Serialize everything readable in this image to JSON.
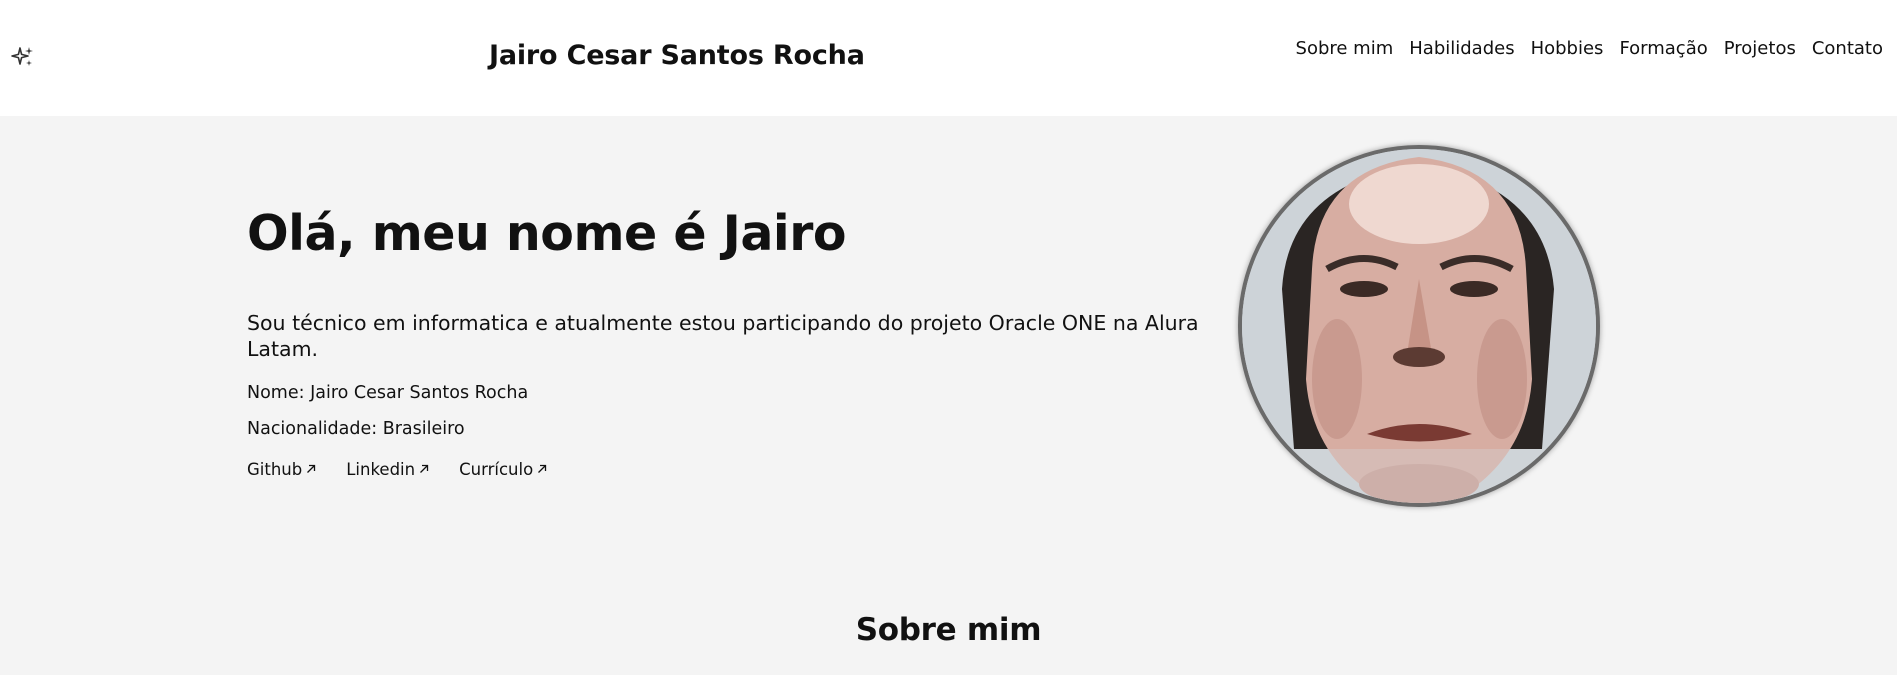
{
  "header": {
    "icon": "sparkle-icon",
    "site_title": "Jairo Cesar Santos Rocha",
    "nav": [
      "Sobre mim",
      "Habilidades",
      "Hobbies",
      "Formação",
      "Projetos",
      "Contato"
    ]
  },
  "hero": {
    "heading": "Olá, meu nome é Jairo",
    "description": "Sou técnico em informatica e atualmente estou participando do projeto Oracle ONE na Alura Latam.",
    "name_line": "Nome: Jairo Cesar Santos Rocha",
    "nationality_line": "Nacionalidade: Brasileiro",
    "links": [
      "Github",
      "Linkedin",
      "Currículo"
    ],
    "link_icon": "arrow-up-right-icon"
  },
  "sections": {
    "about_title": "Sobre mim"
  },
  "colors": {
    "header_bg": "#ffffff",
    "page_bg": "#f4f4f4",
    "text": "#111111"
  }
}
